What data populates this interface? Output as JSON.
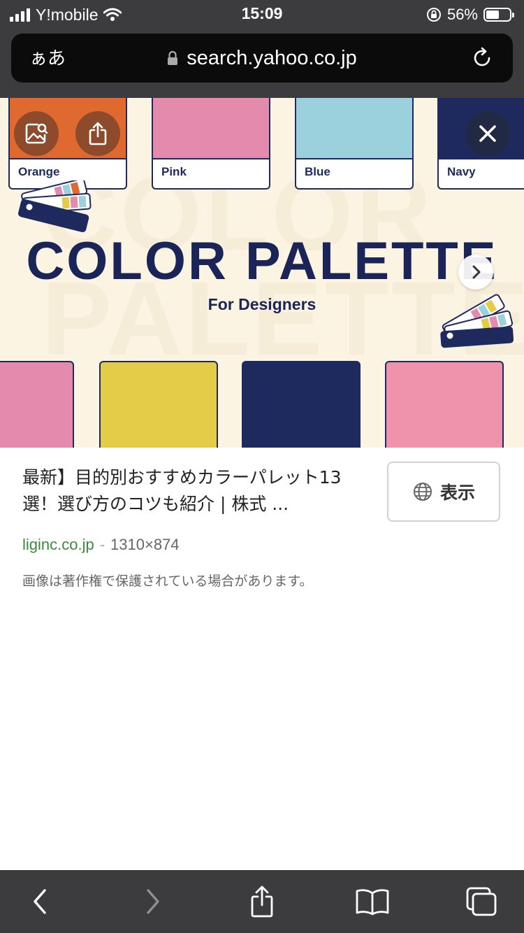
{
  "status_bar": {
    "carrier": "Y!mobile",
    "time": "15:09",
    "battery_percent": "56%",
    "battery_level": 0.56
  },
  "url_bar": {
    "text_size_label": "ぁあ",
    "url": "search.yahoo.co.jp"
  },
  "image": {
    "swatches": [
      "Orange",
      "Pink",
      "Blue",
      "Navy"
    ],
    "title": "COLOR PALETTE",
    "subtitle": "For Designers",
    "colors": {
      "orange": "#e0692f",
      "pink": "#e48aad",
      "blue": "#9ad1dd",
      "navy": "#1e2a5e",
      "yellow": "#e4cb48",
      "rose": "#ee93ab",
      "background": "#fbf4e2"
    }
  },
  "result": {
    "title": "最新】目的別おすすめカラーパレット13選！選び方のコツも紹介 | 株式 ...",
    "show_button_label": "表示",
    "domain": "liginc.co.jp",
    "separator": "-",
    "dimensions": "1310×874",
    "notice": "画像は著作権で保護されている場合があります。"
  },
  "toolbar": {
    "icons": [
      "back-icon",
      "forward-icon",
      "share-icon",
      "bookmarks-icon",
      "tabs-icon"
    ]
  }
}
